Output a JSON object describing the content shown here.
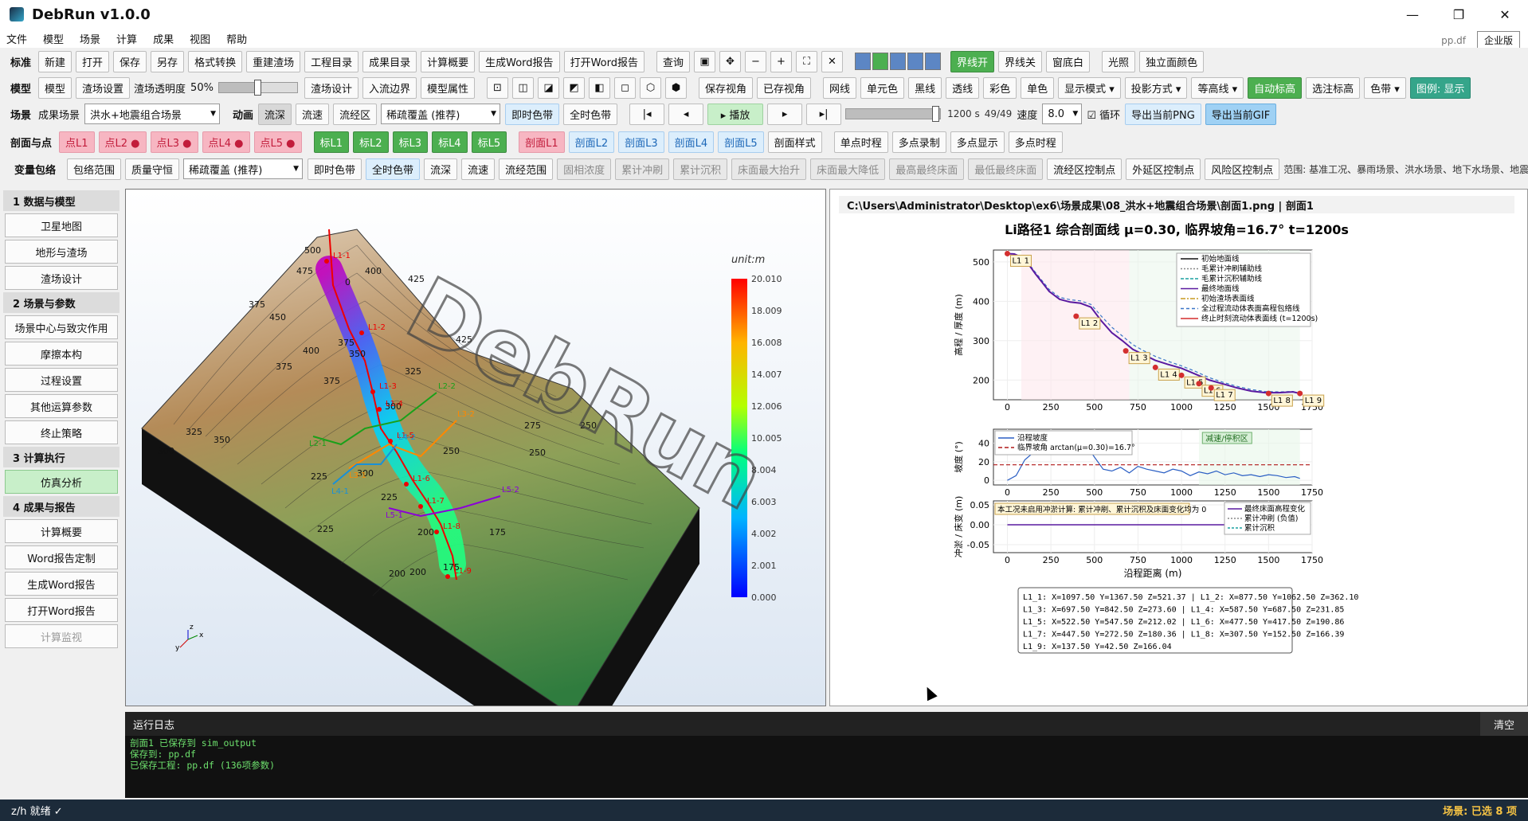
{
  "app": {
    "title": "DebRun v1.0.0",
    "window_controls": [
      "—",
      "❐",
      "✕"
    ]
  },
  "menu": {
    "items": [
      "文件",
      "模型",
      "场景",
      "计算",
      "成果",
      "视图",
      "帮助"
    ],
    "project_file": "pp.df",
    "edition": "企业版"
  },
  "rows": {
    "r1": {
      "label": "标准",
      "buttons": [
        "新建",
        "打开",
        "保存",
        "另存",
        "格式转换",
        "重建渣场",
        "工程目录",
        "成果目录",
        "计算概要",
        "生成Word报告",
        "打开Word报告"
      ],
      "query": "查询",
      "nav_icons": [
        "▣",
        "✥",
        "−",
        "+",
        "⛶",
        "✕"
      ],
      "right": [
        "界线开",
        "界线关",
        "窗底白",
        "光照",
        "独立面颜色"
      ]
    },
    "r2": {
      "label": "模型",
      "buttons": [
        "模型",
        "渣场设置"
      ],
      "opacity_label": "渣场透明度",
      "opacity_value": "50%",
      "opacity_fraction": 0.5,
      "buttons2": [
        "渣场设计",
        "入流边界",
        "模型属性"
      ],
      "cubes": [
        "⊡",
        "◫",
        "◪",
        "◩",
        "◧",
        "◻",
        "⬡",
        "⬢"
      ],
      "view_btns": [
        "保存视角",
        "已存视角"
      ],
      "render": [
        "网线",
        "单元色",
        "黑线",
        "透线",
        "彩色",
        "单色"
      ],
      "menus": [
        "显示模式 ▾",
        "投影方式 ▾",
        "等高线 ▾"
      ],
      "auto": "自动标高",
      "pick": "选注标高",
      "band": "色带 ▾",
      "legend": "图例: 显示"
    },
    "r3": {
      "label": "场景",
      "result_label": "成果场景",
      "scene": "洪水+地震组合场景",
      "anim_label": "动画",
      "tabs": [
        "流深",
        "流速",
        "流经区"
      ],
      "overlay": "稀疏覆盖 (推荐)",
      "colorband": [
        "即时色带",
        "全时色带"
      ],
      "play": [
        "|◂",
        "◂",
        "▸ 播放",
        "▸",
        "▸|"
      ],
      "time": "1200 s",
      "frame": "49/49",
      "frame_fraction": 1,
      "speed_label": "速度",
      "speed": "8.0",
      "loop": "循环",
      "export_png": "导出当前PNG",
      "export_gif": "导出当前GIF"
    },
    "r4": {
      "label": "剖面与点",
      "points": [
        "点L1",
        "点L2 ●",
        "点L3 ●",
        "点L4 ●",
        "点L5 ●"
      ],
      "marks": [
        "标L1",
        "标L2",
        "标L3",
        "标L4",
        "标L5"
      ],
      "sections": [
        "剖面L1",
        "剖面L2",
        "剖面L3",
        "剖面L4",
        "剖面L5"
      ],
      "tools": [
        "剖面样式",
        "单点时程",
        "多点录制",
        "多点显示",
        "多点时程"
      ]
    },
    "r5": {
      "label": "变量包络",
      "buttons": [
        "包络范围",
        "质量守恒"
      ],
      "overlay": "稀疏覆盖 (推荐)",
      "colorband": [
        "即时色带",
        "全时色带"
      ],
      "vars": [
        "流深",
        "流速",
        "流经范围"
      ],
      "disabled": [
        "固相浓度",
        "累计冲刷",
        "累计沉积",
        "床面最大抬升",
        "床面最大降低",
        "最高最终床面",
        "最低最终床面"
      ],
      "zones": [
        "流经区控制点",
        "外延区控制点",
        "风险区控制点"
      ],
      "range": "范围: 基准工况、暴雨场景、洪水场景、地下水场景、地震场景"
    }
  },
  "sidebar": {
    "sections": [
      {
        "title": "1  数据与模型",
        "items": [
          "卫星地图",
          "地形与渣场",
          "渣场设计"
        ]
      },
      {
        "title": "2  场景与参数",
        "items": [
          "场景中心与致灾作用",
          "摩擦本构",
          "过程设置",
          "其他运算参数",
          "终止策略"
        ]
      },
      {
        "title": "3  计算执行",
        "items": [
          "仿真分析"
        ]
      },
      {
        "title": "4  成果与报告",
        "items": [
          "计算概要",
          "Word报告定制",
          "生成Word报告",
          "打开Word报告",
          "计算监视"
        ]
      }
    ]
  },
  "view3d": {
    "unit": "unit:m",
    "colorbar": [
      "20.010",
      "18.009",
      "16.008",
      "14.007",
      "12.006",
      "10.005",
      "8.004",
      "6.003",
      "4.002",
      "2.001",
      "0.000"
    ],
    "watermark": "DebRun",
    "contour_labels": [
      "500",
      "475",
      "400",
      "425",
      "375",
      "375",
      "450",
      "400",
      "425",
      "375",
      "350",
      "325",
      "375",
      "300",
      "325",
      "350",
      "300",
      "225",
      "250",
      "225",
      "250",
      "225",
      "200",
      "175",
      "200",
      "175",
      "200",
      "250",
      "275",
      "300",
      "0"
    ],
    "point_labels": [
      "L1-1",
      "L1-2",
      "L1-3",
      "L1-4",
      "L1-5",
      "L1-6",
      "L1-7",
      "L1-8",
      "L1-9"
    ],
    "section_labels": [
      "L2-1",
      "L2-2",
      "L3-1",
      "L3-2",
      "L4-1",
      "L4-2",
      "L5-1",
      "L5-2"
    ],
    "axis_labels": [
      "y",
      "z",
      "x"
    ]
  },
  "plot": {
    "path": "C:\\Users\\Administrator\\Desktop\\ex6\\场景成果\\08_洪水+地震组合场景\\剖面1.png  |  剖面1",
    "title": "Li路径1 综合剖面线  μ=0.30, 临界坡角=16.7°  t=1200s",
    "legend1": [
      "初始地面线",
      "毛累计冲刷辅助线",
      "毛累计沉积辅助线",
      "最终地面线",
      "初始渣场表面线",
      "全过程流动体表面高程包络线",
      "终止时刻流动体表面线 (t=1200s)"
    ],
    "legend2": [
      "沿程坡度",
      "临界坡角 arctan(μ=0.30)=16.7°"
    ],
    "zone_label": "减速/停积区",
    "note3": "本工况未启用冲淤计算: 累计冲刷、累计沉积及床面变化均为 0",
    "legend3": [
      "最终床面高程变化",
      "累计冲刷 (负值)",
      "累计沉积"
    ],
    "ylabel1": "高程 / 厚度 (m)",
    "ylabel2": "坡度 (°)",
    "ylabel3": "冲淤 / 床变 (m)",
    "xlabel": "沿程距离 (m)",
    "coords": [
      "L1_1: X=1097.50 Y=1367.50 Z=521.37  |  L1_2: X=877.50 Y=1062.50 Z=362.10",
      "L1_3: X=697.50 Y=842.50 Z=273.60  |  L1_4: X=587.50 Y=687.50 Z=231.85",
      "L1_5: X=522.50 Y=547.50 Z=212.02  |  L1_6: X=477.50 Y=417.50 Z=190.86",
      "L1_7: X=447.50 Y=272.50 Z=180.36  |  L1_8: X=307.50 Y=152.50 Z=166.39",
      "L1_9: X=137.50 Y=42.50 Z=166.04"
    ]
  },
  "chart_data": [
    {
      "type": "line",
      "title": "Li路径1 综合剖面线  μ=0.30, 临界坡角=16.7°  t=1200s",
      "xlabel": "",
      "ylabel": "高程 / 厚度 (m)",
      "xlim": [
        -80,
        1750
      ],
      "ylim": [
        150,
        530
      ],
      "xticks": [
        0,
        250,
        500,
        750,
        1000,
        1250,
        1500,
        1750
      ],
      "yticks": [
        200,
        300,
        400,
        500
      ],
      "x": [
        0,
        40,
        80,
        120,
        160,
        200,
        240,
        300,
        360,
        420,
        480,
        540,
        600,
        660,
        720,
        780,
        850,
        920,
        1000,
        1080,
        1160,
        1240,
        1320,
        1400,
        1480,
        1560,
        1640,
        1680
      ],
      "series": [
        {
          "name": "最终地面线",
          "values": [
            521,
            520,
            512,
            495,
            470,
            448,
            425,
            405,
            398,
            395,
            385,
            350,
            320,
            300,
            278,
            265,
            250,
            240,
            230,
            215,
            200,
            190,
            180,
            172,
            168,
            168,
            170,
            166
          ]
        },
        {
          "name": "全过程流动体表面高程包络线",
          "values": [
            521,
            520,
            513,
            497,
            474,
            452,
            430,
            410,
            404,
            401,
            392,
            362,
            334,
            312,
            290,
            275,
            260,
            248,
            236,
            222,
            206,
            194,
            184,
            176,
            171,
            170,
            171,
            166
          ]
        }
      ],
      "points": [
        {
          "label": "L1_1",
          "x": 0,
          "y": 521
        },
        {
          "label": "L1_2",
          "x": 395,
          "y": 362
        },
        {
          "label": "L1_3",
          "x": 680,
          "y": 274
        },
        {
          "label": "L1_4",
          "x": 850,
          "y": 232
        },
        {
          "label": "L1_5",
          "x": 1000,
          "y": 212
        },
        {
          "label": "L1_6",
          "x": 1100,
          "y": 191
        },
        {
          "label": "L1_7",
          "x": 1170,
          "y": 180
        },
        {
          "label": "L1_8",
          "x": 1500,
          "y": 166
        },
        {
          "label": "L1_9",
          "x": 1680,
          "y": 166
        }
      ]
    },
    {
      "type": "line",
      "ylabel": "坡度 (°)",
      "xlim": [
        -80,
        1750
      ],
      "ylim": [
        -5,
        55
      ],
      "xticks": [
        0,
        250,
        500,
        750,
        1000,
        1250,
        1500,
        1750
      ],
      "yticks": [
        0,
        20,
        40
      ],
      "x": [
        0,
        50,
        100,
        150,
        200,
        250,
        300,
        350,
        400,
        450,
        500,
        550,
        600,
        650,
        700,
        750,
        800,
        850,
        900,
        950,
        1000,
        1050,
        1100,
        1150,
        1200,
        1250,
        1300,
        1350,
        1400,
        1450,
        1500,
        1550,
        1600,
        1650,
        1680
      ],
      "series": [
        {
          "name": "沿程坡度",
          "values": [
            0,
            5,
            22,
            30,
            35,
            28,
            40,
            45,
            30,
            38,
            25,
            12,
            10,
            14,
            8,
            15,
            12,
            10,
            8,
            12,
            10,
            5,
            9,
            7,
            10,
            6,
            8,
            5,
            6,
            4,
            6,
            5,
            3,
            4,
            2
          ]
        },
        {
          "name": "临界坡角 arctan(μ=0.30)=16.7°",
          "values": [
            16.7,
            16.7
          ]
        }
      ]
    },
    {
      "type": "line",
      "xlabel": "沿程距离 (m)",
      "ylabel": "冲淤 / 床变 (m)",
      "xlim": [
        -80,
        1750
      ],
      "ylim": [
        -0.07,
        0.06
      ],
      "xticks": [
        0,
        250,
        500,
        750,
        1000,
        1250,
        1500,
        1750
      ],
      "yticks": [
        -0.05,
        0.0,
        0.05
      ],
      "x": [
        0,
        1680
      ],
      "series": [
        {
          "name": "最终床面高程变化",
          "values": [
            0,
            0
          ]
        },
        {
          "name": "累计冲刷 (负值)",
          "values": [
            0,
            0
          ]
        },
        {
          "name": "累计沉积",
          "values": [
            0,
            0
          ]
        }
      ]
    }
  ],
  "log": {
    "title": "运行日志",
    "clear": "清空",
    "lines": [
      "剖面1 已保存到 sim_output",
      "保存到: pp.df",
      "已保存工程: pp.df (136项参数)"
    ]
  },
  "status": {
    "left": "z/h 就绪 ✓",
    "right": "场景: 已选 8 项"
  }
}
